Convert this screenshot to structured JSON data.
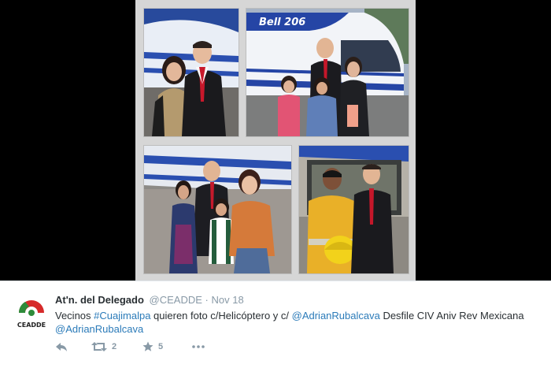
{
  "media": {
    "photos": [
      {
        "label": "photo-1"
      },
      {
        "label": "photo-2",
        "helicopter_text": "Bell 206"
      },
      {
        "label": "photo-3"
      },
      {
        "label": "photo-4"
      }
    ]
  },
  "tweet": {
    "avatar_text": "CEADDE",
    "name": "At'n. del Delegado",
    "handle": "@CEADDE",
    "separator": "·",
    "time": "Nov 18",
    "text_1": "Vecinos ",
    "hashtag": "#Cuajimalpa",
    "text_2": " quieren foto c/Helicóptero y c/ ",
    "mention_1": "@AdrianRubalcava",
    "text_3": " Desfile CIV Aniv Rev Mexicana ",
    "mention_2": "@AdrianRubalcava",
    "actions": {
      "reply_icon": "reply-icon",
      "retweet_icon": "retweet-icon",
      "retweet_count": "2",
      "favorite_icon": "star-icon",
      "favorite_count": "5",
      "more_icon": "more-icon"
    }
  },
  "colors": {
    "link": "#2b7bb9",
    "meta": "#8899a6",
    "name": "#292f33"
  }
}
